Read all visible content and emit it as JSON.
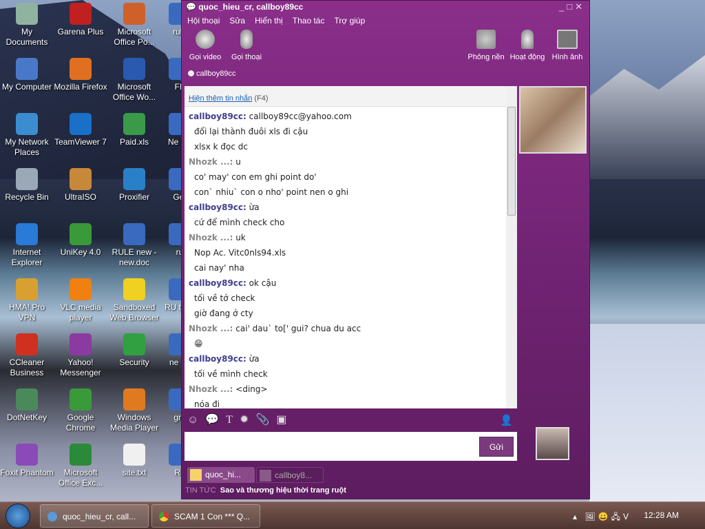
{
  "desktop": {
    "icons": [
      {
        "label": "My Documents",
        "col": 0,
        "color": "#8fb3a0"
      },
      {
        "label": "My Computer",
        "col": 0,
        "color": "#4a78c8"
      },
      {
        "label": "My Network Places",
        "col": 0,
        "color": "#3c8cd0"
      },
      {
        "label": "Recycle Bin",
        "col": 0,
        "color": "#9aa8b8"
      },
      {
        "label": "Internet Explorer",
        "col": 0,
        "color": "#2a7ad8"
      },
      {
        "label": "HMA! Pro VPN",
        "col": 0,
        "color": "#d8a030"
      },
      {
        "label": "CCleaner Business",
        "col": 0,
        "color": "#d03020"
      },
      {
        "label": "DotNetKey",
        "col": 0,
        "color": "#4a8a5a"
      },
      {
        "label": "Foxit Phantom",
        "col": 0,
        "color": "#8a4ab8"
      },
      {
        "label": "Garena Plus",
        "col": 1,
        "color": "#c02020"
      },
      {
        "label": "Mozilla Firefox",
        "col": 1,
        "color": "#e07020"
      },
      {
        "label": "TeamViewer 7",
        "col": 1,
        "color": "#1a70c8"
      },
      {
        "label": "UltraISO",
        "col": 1,
        "color": "#c8883a"
      },
      {
        "label": "UniKey 4.0",
        "col": 1,
        "color": "#3a9a3a"
      },
      {
        "label": "VLC media player",
        "col": 1,
        "color": "#f08010"
      },
      {
        "label": "Yahoo! Messenger",
        "col": 1,
        "color": "#8a3aa0"
      },
      {
        "label": "Google Chrome",
        "col": 1,
        "color": "#3a9a3a"
      },
      {
        "label": "Microsoft Office Exc...",
        "col": 1,
        "color": "#2a8a3a"
      },
      {
        "label": "Microsoft Office Po...",
        "col": 2,
        "color": "#d0602a"
      },
      {
        "label": "Microsoft Office Wo...",
        "col": 2,
        "color": "#2a5ab0"
      },
      {
        "label": "Paid.xls",
        "col": 2,
        "color": "#3a9a4a"
      },
      {
        "label": "Proxifier",
        "col": 2,
        "color": "#2a80c8"
      },
      {
        "label": "RULE new - new.doc",
        "col": 2,
        "color": "#3a6ac0"
      },
      {
        "label": "Sandboxed Web Browser",
        "col": 2,
        "color": "#f0d020"
      },
      {
        "label": "Security",
        "col": 2,
        "color": "#30a040"
      },
      {
        "label": "Windows Media Player",
        "col": 2,
        "color": "#e07a20"
      },
      {
        "label": "site.txt",
        "col": 2,
        "color": "#f0f0f0"
      },
      {
        "label": "rule",
        "col": 3,
        "color": "#3a6ac0"
      },
      {
        "label": "FF",
        "col": 3,
        "color": "#3a6ac0"
      },
      {
        "label": "Ne Do",
        "col": 3,
        "color": "#3a6ac0"
      },
      {
        "label": "Get",
        "col": 3,
        "color": "#3a6ac0"
      },
      {
        "label": "ru",
        "col": 3,
        "color": "#3a6ac0"
      },
      {
        "label": "RU tiger",
        "col": 3,
        "color": "#3a6ac0"
      },
      {
        "label": "ne au",
        "col": 3,
        "color": "#3a6ac0"
      },
      {
        "label": "gro",
        "col": 3,
        "color": "#3a6ac0"
      },
      {
        "label": "Ru",
        "col": 3,
        "color": "#3a6ac0"
      }
    ]
  },
  "chat": {
    "title": "quoc_hieu_cr, callboy89cc",
    "menu": [
      "Hội thoại",
      "Sửa",
      "Hiển thị",
      "Thao tác",
      "Trợ giúp"
    ],
    "toolbar": {
      "video": "Gọi video",
      "voice": "Gọi thoại",
      "background": "Phông nền",
      "activity": "Hoạt động",
      "photos": "Hình ảnh"
    },
    "contact": "callboy89cc",
    "show_more": "Hiện thêm tin nhắn",
    "show_more_key": "(F4)",
    "messages": [
      {
        "sender": "callboy89cc:",
        "self": false,
        "lines": [
          "callboy89cc@yahoo.com",
          "đổi lại thành đuôi xls đi cậu",
          "xlsx k đọc dc"
        ]
      },
      {
        "sender": "Nhozk ...:",
        "self": true,
        "lines": [
          "u",
          "co' may' con em ghi point do'",
          "con` nhiu` con o nho' point nen o ghi"
        ]
      },
      {
        "sender": "callboy89cc:",
        "self": false,
        "lines": [
          "ừa",
          "cứ để mình check cho"
        ]
      },
      {
        "sender": "Nhozk ...:",
        "self": true,
        "lines": [
          "uk",
          "Nop Ac. Vitc0nls94.xls",
          "cai nay' nha"
        ]
      },
      {
        "sender": "callboy89cc:",
        "self": false,
        "lines": [
          "ok cậu",
          "tối về tớ check",
          "giờ đang ở cty"
        ]
      },
      {
        "sender": "Nhozk ...:",
        "self": true,
        "lines": [
          "cai' dau` to[' gui? chua du acc",
          "😁"
        ]
      },
      {
        "sender": "callboy89cc:",
        "self": false,
        "lines": [
          "ừa",
          "tối về mình check"
        ]
      },
      {
        "sender": "Nhozk ...:",
        "self": true,
        "lines": [
          "<ding>",
          "nóa đi"
        ]
      }
    ],
    "send_label": "Gửi",
    "tabs": [
      "quoc_hi...",
      "callboy8..."
    ],
    "news_label": "TIN TỨC",
    "news_text": "Sao và thương hiệu thời trang ruột"
  },
  "taskbar": {
    "tasks": [
      "quoc_hieu_cr, call...",
      "SCAM 1 Con *** Q..."
    ],
    "clock": "12:28 AM"
  }
}
